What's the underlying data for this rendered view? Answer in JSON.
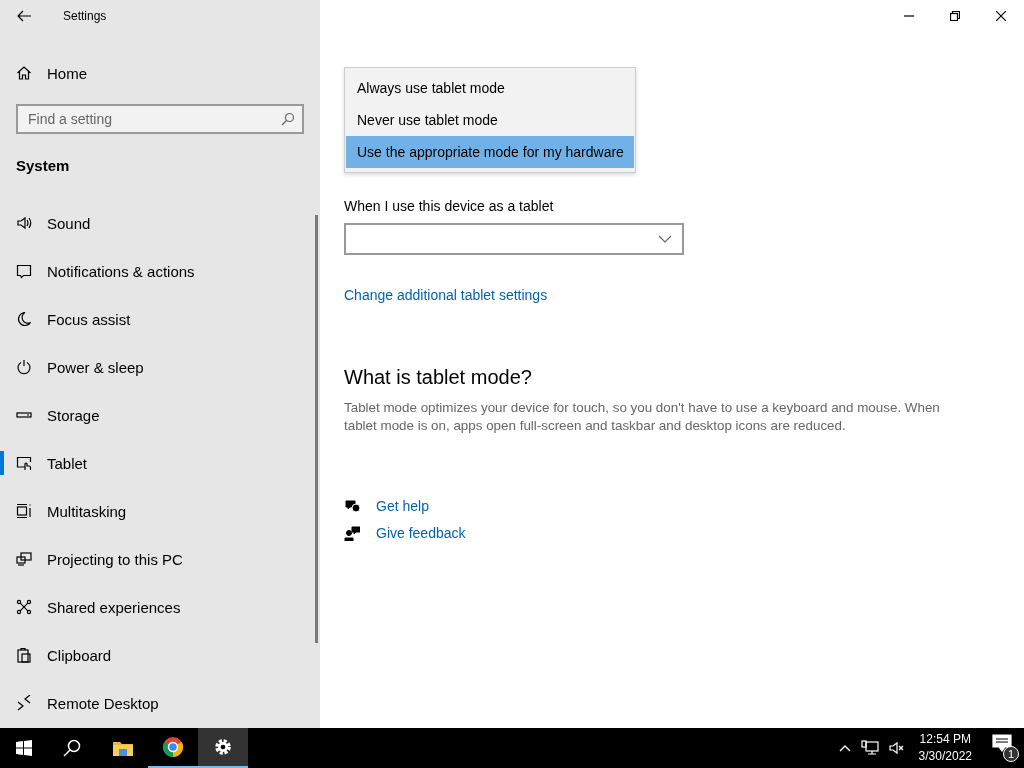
{
  "window": {
    "title": "Settings"
  },
  "sidebar": {
    "home": "Home",
    "search": {
      "placeholder": "Find a setting"
    },
    "section": "System",
    "items": [
      {
        "label": "Sound",
        "selected": false
      },
      {
        "label": "Notifications & actions",
        "selected": false
      },
      {
        "label": "Focus assist",
        "selected": false
      },
      {
        "label": "Power & sleep",
        "selected": false
      },
      {
        "label": "Storage",
        "selected": false
      },
      {
        "label": "Tablet",
        "selected": true
      },
      {
        "label": "Multitasking",
        "selected": false
      },
      {
        "label": "Projecting to this PC",
        "selected": false
      },
      {
        "label": "Shared experiences",
        "selected": false
      },
      {
        "label": "Clipboard",
        "selected": false
      },
      {
        "label": "Remote Desktop",
        "selected": false
      }
    ]
  },
  "mode_dropdown": {
    "expanded": true,
    "options": [
      {
        "label": "Always use tablet mode",
        "selected": false
      },
      {
        "label": "Never use tablet mode",
        "selected": false
      },
      {
        "label": "Use the appropriate mode for my hardware",
        "selected": true
      }
    ]
  },
  "tablet_dropdown": {
    "label": "When I use this device as a tablet"
  },
  "additional_link": "Change additional tablet settings",
  "info": {
    "heading": "What is tablet mode?",
    "text": "Tablet mode optimizes your device for touch, so you don't have to use a keyboard and mouse. When tablet mode is on, apps open full-screen and taskbar and desktop icons are reduced."
  },
  "help_links": [
    "Get help",
    "Give feedback"
  ],
  "taskbar": {
    "apps": [
      {
        "running": false,
        "selected": false
      },
      {
        "running": true,
        "selected": false
      },
      {
        "running": true,
        "selected": true
      }
    ],
    "time": "12:54 PM",
    "date": "3/30/2022",
    "notification_count": "1"
  }
}
